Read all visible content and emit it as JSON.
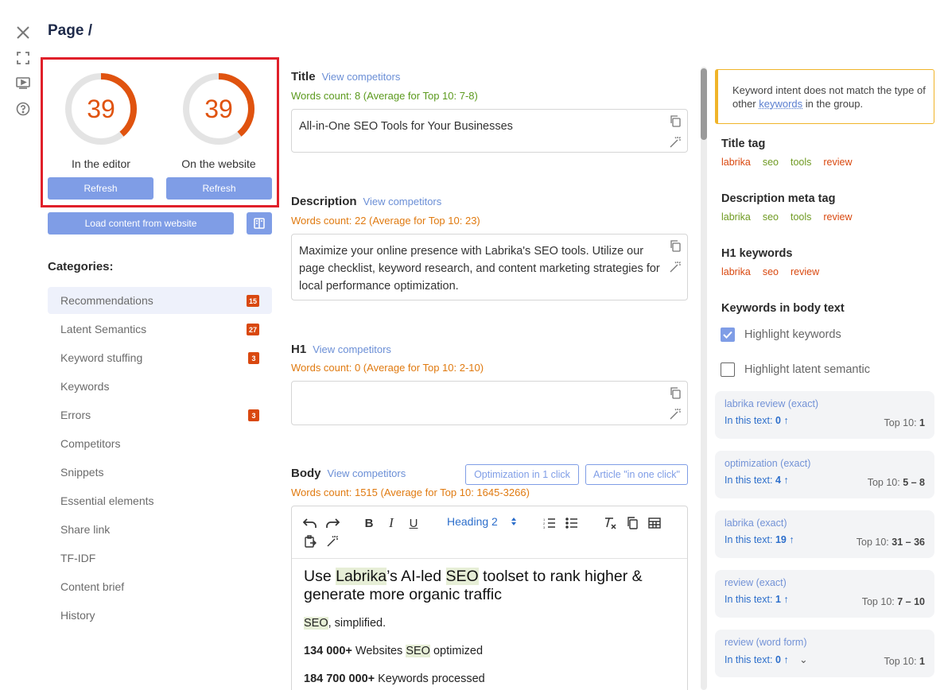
{
  "page": {
    "title": "Page /"
  },
  "scores": {
    "editor": {
      "value": "39",
      "label": "In the editor",
      "fraction": 0.39
    },
    "website": {
      "value": "39",
      "label": "On the website",
      "fraction": 0.39
    },
    "refresh_label": "Refresh",
    "load_label": "Load content from website"
  },
  "categories": {
    "title": "Categories:",
    "items": [
      {
        "label": "Recommendations",
        "badge": "15"
      },
      {
        "label": "Latent Semantics",
        "badge": "27"
      },
      {
        "label": "Keyword stuffing",
        "badge": "3"
      },
      {
        "label": "Keywords",
        "badge": ""
      },
      {
        "label": "Errors",
        "badge": "3"
      },
      {
        "label": "Competitors",
        "badge": ""
      },
      {
        "label": "Snippets",
        "badge": ""
      },
      {
        "label": "Essential elements",
        "badge": ""
      },
      {
        "label": "Share link",
        "badge": ""
      },
      {
        "label": "TF-IDF",
        "badge": ""
      },
      {
        "label": "Content brief",
        "badge": ""
      },
      {
        "label": "History",
        "badge": ""
      }
    ]
  },
  "sections": {
    "view_competitors": "View competitors",
    "title": {
      "label": "Title",
      "words": "Words count: 8 (Average for Top 10: 7-8)",
      "value": "All-in-One SEO Tools for Your Businesses"
    },
    "description": {
      "label": "Description",
      "words": "Words count: 22 (Average for Top 10: 23)",
      "value": "Maximize your online presence with Labrika's SEO tools. Utilize our page checklist, keyword research, and content marketing strategies for local performance optimization."
    },
    "h1": {
      "label": "H1",
      "words": "Words count: 0 (Average for Top 10: 2-10)",
      "value": ""
    },
    "body": {
      "label": "Body",
      "words": "Words count: 1515 (Average for Top 10: 1645-3266)",
      "opt_button": "Optimization in 1 click",
      "article_button": "Article \"in one click\""
    }
  },
  "editor": {
    "heading_select": "Heading 2",
    "h_pre": "Use ",
    "h_kw1": "Labrika",
    "h_mid": "’s AI-led ",
    "h_kw2": "SEO",
    "h_post": " toolset to rank higher & generate more organic traffic",
    "p1_kw": "SEO",
    "p1_rest": ", simplified.",
    "p2_bold": "134 000+",
    "p2_pre": " Websites ",
    "p2_kw": "SEO",
    "p2_post": " optimized",
    "p3_bold": "184 700 000+",
    "p3_rest": " Keywords processed"
  },
  "right": {
    "warning_pre": "Keyword intent does not match the type of other ",
    "warning_link": "keywords",
    "warning_post": " in the group.",
    "title_tag": {
      "label": "Title tag",
      "tags": [
        "labrika",
        "seo",
        "tools",
        "review"
      ]
    },
    "desc_tag": {
      "label": "Description meta tag",
      "tags": [
        "labrika",
        "seo",
        "tools",
        "review"
      ]
    },
    "h1_keywords": {
      "label": "H1 keywords",
      "tags": [
        "labrika",
        "seo",
        "review"
      ]
    },
    "body_keywords": {
      "label": "Keywords in body text"
    },
    "highlight_keywords": {
      "label": "Highlight keywords",
      "checked": true
    },
    "highlight_latent": {
      "label": "Highlight latent semantic",
      "checked": false
    },
    "in_text_label": "In this text:",
    "top_label": "Top 10:",
    "keywords": [
      {
        "name": "labrika review (exact)",
        "in_text": "0",
        "top": "1"
      },
      {
        "name": "optimization (exact)",
        "in_text": "4",
        "top": "5 – 8"
      },
      {
        "name": "labrika (exact)",
        "in_text": "19",
        "top": "31 – 36"
      },
      {
        "name": "review (exact)",
        "in_text": "1",
        "top": "7 – 10"
      },
      {
        "name": "review (word form)",
        "in_text": "0",
        "top": "1"
      }
    ]
  },
  "colors": {
    "accent": "#7f9de6",
    "score": "#e0530f",
    "highlight_box": "#e0202a",
    "warning": "#f0b429"
  }
}
